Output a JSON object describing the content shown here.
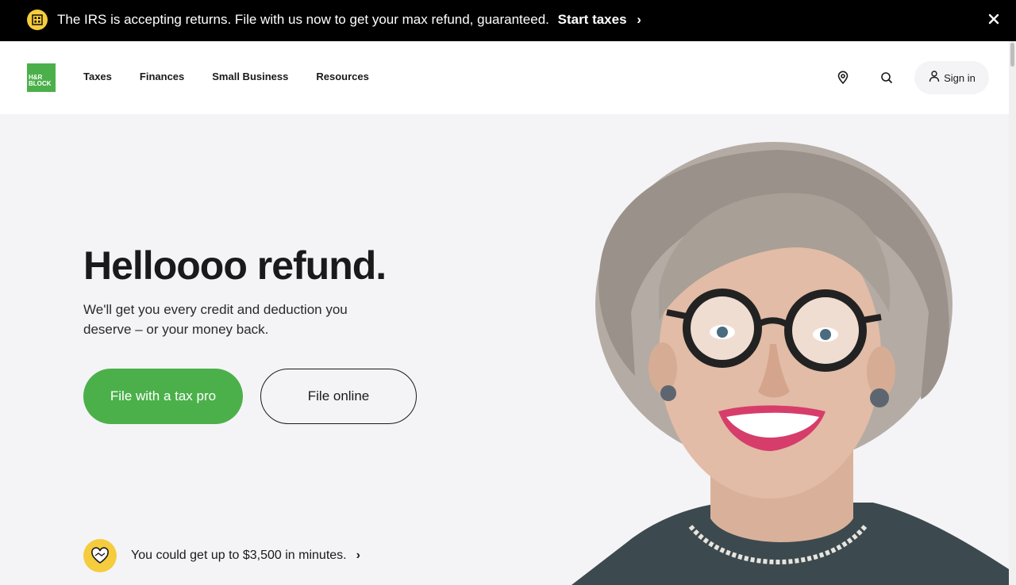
{
  "banner": {
    "message": "The IRS is accepting returns. File with us now to get your max refund, guaranteed.",
    "cta": "Start taxes",
    "icon": "building-icon",
    "close_icon": "close-icon"
  },
  "nav": {
    "logo_line1": "H&R",
    "logo_line2": "BLOCK",
    "links": [
      "Taxes",
      "Finances",
      "Small Business",
      "Resources"
    ],
    "location_icon": "location-pin-icon",
    "search_icon": "search-icon",
    "signin_label": "Sign in",
    "signin_icon": "user-icon"
  },
  "hero": {
    "headline": "Helloooo refund.",
    "subtext": "We'll get you every credit and deduction you deserve – or your money back.",
    "primary_button": "File with a tax pro",
    "secondary_button": "File online",
    "promo_text": "You could get up to $3,500 in minutes.",
    "promo_icon": "handshake-heart-icon"
  },
  "colors": {
    "brand_green": "#4bb04a",
    "accent_yellow": "#f5cc3d",
    "banner_bg": "#000000",
    "hero_bg": "#f4f4f7"
  }
}
